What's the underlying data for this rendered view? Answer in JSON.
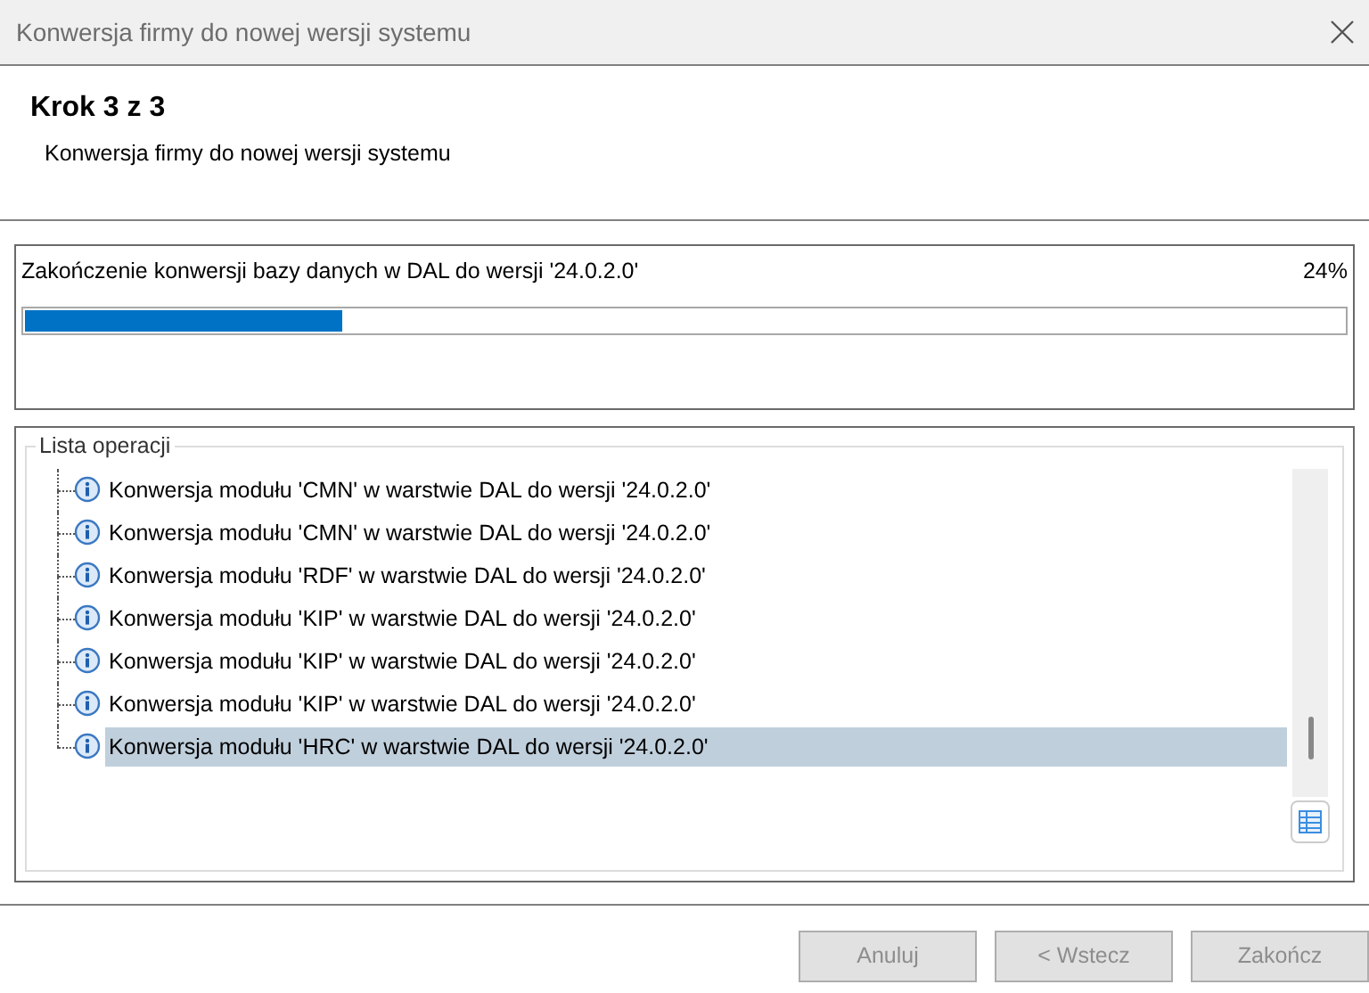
{
  "window": {
    "title": "Konwersja firmy do nowej wersji systemu"
  },
  "header": {
    "step": "Krok 3 z 3",
    "subtitle": "Konwersja firmy do nowej wersji systemu"
  },
  "progress": {
    "label": "Zakończenie konwersji bazy danych w DAL do wersji '24.0.2.0'",
    "percent": "24%",
    "level": 0.24
  },
  "operations": {
    "title": "Lista operacji",
    "items": [
      {
        "text": "Konwersja modułu 'CMN' w warstwie DAL do wersji '24.0.2.0'",
        "selected": false
      },
      {
        "text": "Konwersja modułu 'CMN' w warstwie DAL do wersji '24.0.2.0'",
        "selected": false
      },
      {
        "text": "Konwersja modułu 'RDF' w warstwie DAL do wersji '24.0.2.0'",
        "selected": false
      },
      {
        "text": "Konwersja modułu 'KIP' w warstwie DAL do wersji '24.0.2.0'",
        "selected": false
      },
      {
        "text": "Konwersja modułu 'KIP' w warstwie DAL do wersji '24.0.2.0'",
        "selected": false
      },
      {
        "text": "Konwersja modułu 'KIP' w warstwie DAL do wersji '24.0.2.0'",
        "selected": false
      },
      {
        "text": "Konwersja modułu 'HRC' w warstwie DAL do wersji '24.0.2.0'",
        "selected": true
      }
    ]
  },
  "buttons": [
    {
      "label": "Anuluj",
      "disabled": true
    },
    {
      "label": "< Wstecz",
      "disabled": true
    },
    {
      "label": "Zakończ",
      "disabled": true
    }
  ]
}
